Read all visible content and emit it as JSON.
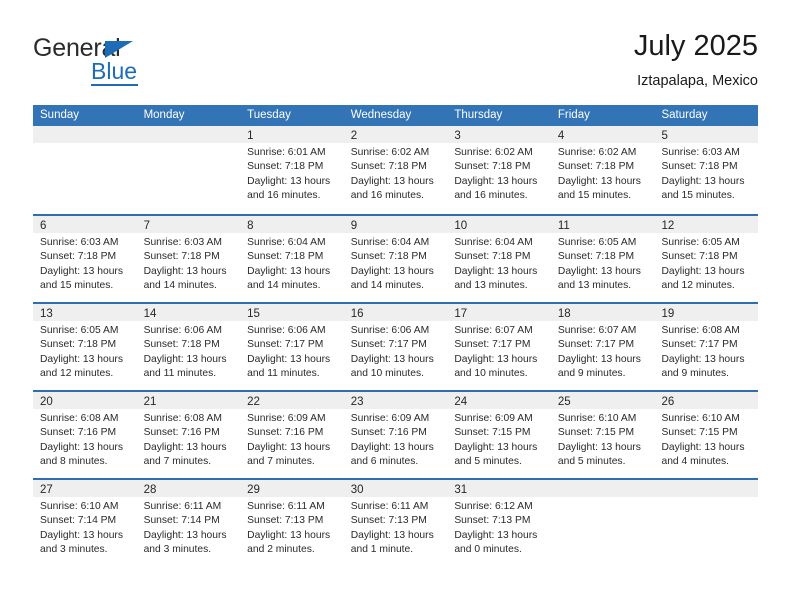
{
  "brand": {
    "name_top": "General",
    "name_bottom": "Blue",
    "accent_color": "#1d6cb5",
    "triangle_icon": "triangle-icon"
  },
  "header": {
    "title": "July 2025",
    "location": "Iztapalapa, Mexico"
  },
  "calendar": {
    "header_bg": "#3274b6",
    "row_divider_color": "#2f6fb0",
    "daynum_band_bg": "#efefef",
    "weekday_headers": [
      "Sunday",
      "Monday",
      "Tuesday",
      "Wednesday",
      "Thursday",
      "Friday",
      "Saturday"
    ],
    "weeks": [
      [
        {
          "day": "",
          "lines": []
        },
        {
          "day": "",
          "lines": []
        },
        {
          "day": "1",
          "lines": [
            "Sunrise: 6:01 AM",
            "Sunset: 7:18 PM",
            "Daylight: 13 hours and 16 minutes."
          ]
        },
        {
          "day": "2",
          "lines": [
            "Sunrise: 6:02 AM",
            "Sunset: 7:18 PM",
            "Daylight: 13 hours and 16 minutes."
          ]
        },
        {
          "day": "3",
          "lines": [
            "Sunrise: 6:02 AM",
            "Sunset: 7:18 PM",
            "Daylight: 13 hours and 16 minutes."
          ]
        },
        {
          "day": "4",
          "lines": [
            "Sunrise: 6:02 AM",
            "Sunset: 7:18 PM",
            "Daylight: 13 hours and 15 minutes."
          ]
        },
        {
          "day": "5",
          "lines": [
            "Sunrise: 6:03 AM",
            "Sunset: 7:18 PM",
            "Daylight: 13 hours and 15 minutes."
          ]
        }
      ],
      [
        {
          "day": "6",
          "lines": [
            "Sunrise: 6:03 AM",
            "Sunset: 7:18 PM",
            "Daylight: 13 hours and 15 minutes."
          ]
        },
        {
          "day": "7",
          "lines": [
            "Sunrise: 6:03 AM",
            "Sunset: 7:18 PM",
            "Daylight: 13 hours and 14 minutes."
          ]
        },
        {
          "day": "8",
          "lines": [
            "Sunrise: 6:04 AM",
            "Sunset: 7:18 PM",
            "Daylight: 13 hours and 14 minutes."
          ]
        },
        {
          "day": "9",
          "lines": [
            "Sunrise: 6:04 AM",
            "Sunset: 7:18 PM",
            "Daylight: 13 hours and 14 minutes."
          ]
        },
        {
          "day": "10",
          "lines": [
            "Sunrise: 6:04 AM",
            "Sunset: 7:18 PM",
            "Daylight: 13 hours and 13 minutes."
          ]
        },
        {
          "day": "11",
          "lines": [
            "Sunrise: 6:05 AM",
            "Sunset: 7:18 PM",
            "Daylight: 13 hours and 13 minutes."
          ]
        },
        {
          "day": "12",
          "lines": [
            "Sunrise: 6:05 AM",
            "Sunset: 7:18 PM",
            "Daylight: 13 hours and 12 minutes."
          ]
        }
      ],
      [
        {
          "day": "13",
          "lines": [
            "Sunrise: 6:05 AM",
            "Sunset: 7:18 PM",
            "Daylight: 13 hours and 12 minutes."
          ]
        },
        {
          "day": "14",
          "lines": [
            "Sunrise: 6:06 AM",
            "Sunset: 7:18 PM",
            "Daylight: 13 hours and 11 minutes."
          ]
        },
        {
          "day": "15",
          "lines": [
            "Sunrise: 6:06 AM",
            "Sunset: 7:17 PM",
            "Daylight: 13 hours and 11 minutes."
          ]
        },
        {
          "day": "16",
          "lines": [
            "Sunrise: 6:06 AM",
            "Sunset: 7:17 PM",
            "Daylight: 13 hours and 10 minutes."
          ]
        },
        {
          "day": "17",
          "lines": [
            "Sunrise: 6:07 AM",
            "Sunset: 7:17 PM",
            "Daylight: 13 hours and 10 minutes."
          ]
        },
        {
          "day": "18",
          "lines": [
            "Sunrise: 6:07 AM",
            "Sunset: 7:17 PM",
            "Daylight: 13 hours and 9 minutes."
          ]
        },
        {
          "day": "19",
          "lines": [
            "Sunrise: 6:08 AM",
            "Sunset: 7:17 PM",
            "Daylight: 13 hours and 9 minutes."
          ]
        }
      ],
      [
        {
          "day": "20",
          "lines": [
            "Sunrise: 6:08 AM",
            "Sunset: 7:16 PM",
            "Daylight: 13 hours and 8 minutes."
          ]
        },
        {
          "day": "21",
          "lines": [
            "Sunrise: 6:08 AM",
            "Sunset: 7:16 PM",
            "Daylight: 13 hours and 7 minutes."
          ]
        },
        {
          "day": "22",
          "lines": [
            "Sunrise: 6:09 AM",
            "Sunset: 7:16 PM",
            "Daylight: 13 hours and 7 minutes."
          ]
        },
        {
          "day": "23",
          "lines": [
            "Sunrise: 6:09 AM",
            "Sunset: 7:16 PM",
            "Daylight: 13 hours and 6 minutes."
          ]
        },
        {
          "day": "24",
          "lines": [
            "Sunrise: 6:09 AM",
            "Sunset: 7:15 PM",
            "Daylight: 13 hours and 5 minutes."
          ]
        },
        {
          "day": "25",
          "lines": [
            "Sunrise: 6:10 AM",
            "Sunset: 7:15 PM",
            "Daylight: 13 hours and 5 minutes."
          ]
        },
        {
          "day": "26",
          "lines": [
            "Sunrise: 6:10 AM",
            "Sunset: 7:15 PM",
            "Daylight: 13 hours and 4 minutes."
          ]
        }
      ],
      [
        {
          "day": "27",
          "lines": [
            "Sunrise: 6:10 AM",
            "Sunset: 7:14 PM",
            "Daylight: 13 hours and 3 minutes."
          ]
        },
        {
          "day": "28",
          "lines": [
            "Sunrise: 6:11 AM",
            "Sunset: 7:14 PM",
            "Daylight: 13 hours and 3 minutes."
          ]
        },
        {
          "day": "29",
          "lines": [
            "Sunrise: 6:11 AM",
            "Sunset: 7:13 PM",
            "Daylight: 13 hours and 2 minutes."
          ]
        },
        {
          "day": "30",
          "lines": [
            "Sunrise: 6:11 AM",
            "Sunset: 7:13 PM",
            "Daylight: 13 hours and 1 minute."
          ]
        },
        {
          "day": "31",
          "lines": [
            "Sunrise: 6:12 AM",
            "Sunset: 7:13 PM",
            "Daylight: 13 hours and 0 minutes."
          ]
        },
        {
          "day": "",
          "lines": []
        },
        {
          "day": "",
          "lines": []
        }
      ]
    ]
  }
}
